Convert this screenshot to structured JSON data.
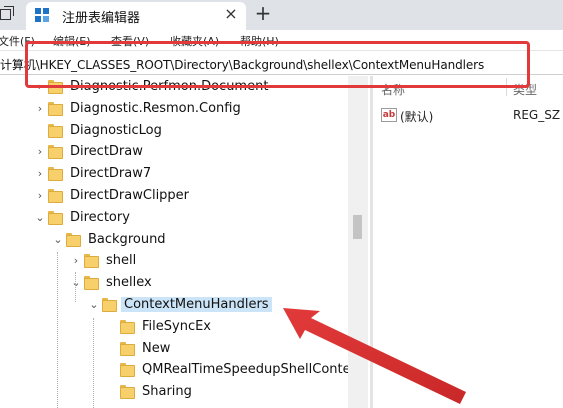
{
  "window": {
    "tab_title": "注册表编辑器",
    "tab_close": "×",
    "new_tab": "+"
  },
  "menubar": {
    "items": [
      "文件(F)",
      "编辑(E)",
      "查看(V)",
      "收藏夹(A)",
      "帮助(H)"
    ]
  },
  "address": {
    "path": "计算机\\HKEY_CLASSES_ROOT\\Directory\\Background\\shellex\\ContextMenuHandlers"
  },
  "tree": {
    "nodes": [
      {
        "label": "Diagnostic.Perfmon.Document",
        "chevron": "›"
      },
      {
        "label": "Diagnostic.Resmon.Config",
        "chevron": "›"
      },
      {
        "label": "DiagnosticLog",
        "chevron": ""
      },
      {
        "label": "DirectDraw",
        "chevron": "›"
      },
      {
        "label": "DirectDraw7",
        "chevron": "›"
      },
      {
        "label": "DirectDrawClipper",
        "chevron": "›"
      },
      {
        "label": "Directory",
        "chevron": "⌄"
      },
      {
        "label": "Background",
        "chevron": "⌄"
      },
      {
        "label": "shell",
        "chevron": "›"
      },
      {
        "label": "shellex",
        "chevron": "⌄"
      },
      {
        "label": "ContextMenuHandlers",
        "chevron": "⌄",
        "selected": true
      },
      {
        "label": "FileSyncEx",
        "chevron": ""
      },
      {
        "label": "New",
        "chevron": ""
      },
      {
        "label": "QMRealTimeSpeedupShellContex",
        "chevron": ""
      },
      {
        "label": "Sharing",
        "chevron": ""
      }
    ]
  },
  "values_pane": {
    "col_name": "名称",
    "col_type": "类型",
    "rows": [
      {
        "icon": "ab",
        "name": "(默认)",
        "type": "REG_SZ"
      }
    ]
  },
  "colors": {
    "highlight": "#e23a3a",
    "selection": "#cce4f7",
    "folder": "#f7d06b"
  }
}
